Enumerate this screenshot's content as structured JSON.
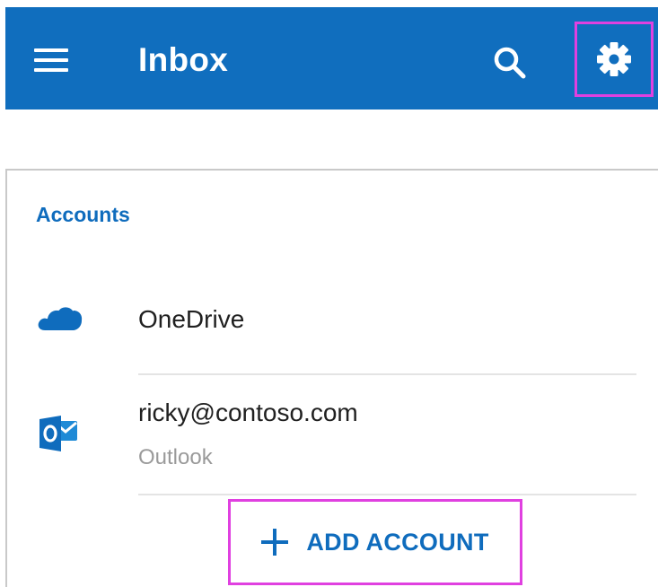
{
  "appbar": {
    "title": "Inbox",
    "background": "#106ebe",
    "icons": {
      "menu": "hamburger-menu-icon",
      "search": "search-icon",
      "settings": "gear-icon"
    }
  },
  "accounts": {
    "section_title": "Accounts",
    "items": [
      {
        "name": "OneDrive",
        "icon": "onedrive-cloud-icon"
      },
      {
        "name": "ricky@contoso.com",
        "subtitle": "Outlook",
        "icon": "outlook-icon"
      }
    ],
    "add_account_label": "ADD ACCOUNT"
  },
  "colors": {
    "accent": "#0f6cbd",
    "highlight": "#e040e0"
  }
}
